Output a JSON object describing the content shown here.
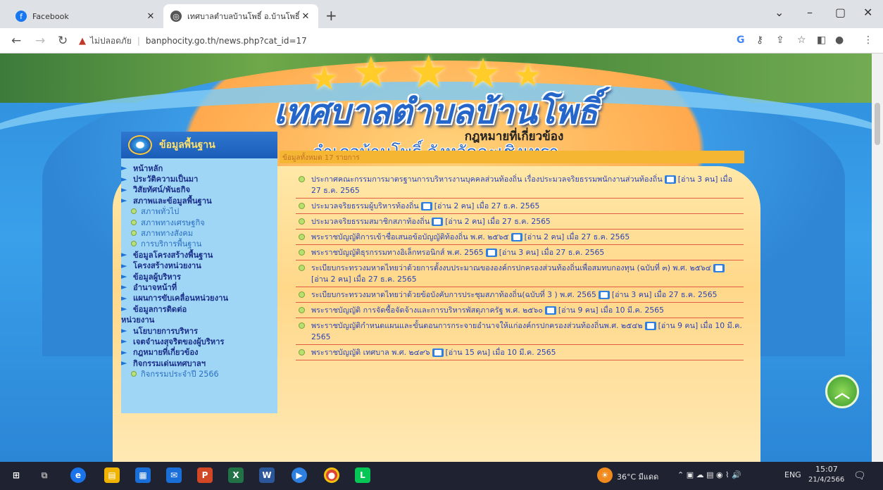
{
  "browser": {
    "tabs": [
      {
        "title": "Facebook",
        "icon": "facebook-icon"
      },
      {
        "title": "เทศบาลตำบลบ้านโพธิ์ อ.บ้านโพธิ์ จ.ฉะ",
        "icon": "globe-icon"
      }
    ],
    "address": {
      "security_label": "ไม่ปลอดภัย",
      "url": "banphocity.go.th/news.php?cat_id=17"
    }
  },
  "site": {
    "title": "เทศบาลตำบลบ้านโพธิ์",
    "subtitle": "อำเภอบ้านโพธิ์ จังหวัดฉะเชิงเทรา"
  },
  "sidebar": {
    "heading": "ข้อมูลพื้นฐาน",
    "items": [
      {
        "label": "หน้าหลัก",
        "type": "main"
      },
      {
        "label": "ประวัติความเป็นมา",
        "type": "main"
      },
      {
        "label": "วิสัยทัศน์/พันธกิจ",
        "type": "main"
      },
      {
        "label": "สภาพและข้อมูลพื้นฐาน",
        "type": "main"
      },
      {
        "label": "สภาพทั่วไป",
        "type": "sub"
      },
      {
        "label": "สภาพทางเศรษฐกิจ",
        "type": "sub"
      },
      {
        "label": "สภาพทางสังคม",
        "type": "sub"
      },
      {
        "label": "การบริการพื้นฐาน",
        "type": "sub"
      },
      {
        "label": "ข้อมูลโครงสร้างพื้นฐาน",
        "type": "main"
      },
      {
        "label": "โครงสร้างหน่วยงาน",
        "type": "main"
      },
      {
        "label": "ข้อมูลผู้บริหาร",
        "type": "main"
      },
      {
        "label": "อำนาจหน้าที่",
        "type": "main"
      },
      {
        "label": "แผนการขับเคลื่อนหน่วยงาน",
        "type": "main"
      },
      {
        "label": "ข้อมูลการติดต่อ",
        "type": "main"
      },
      {
        "label": "หน่วยงาน",
        "type": "cont"
      },
      {
        "label": "นโยบายการบริหาร",
        "type": "main"
      },
      {
        "label": "เจตจำนงสุจริตของผู้บริหาร",
        "type": "main"
      },
      {
        "label": "กฎหมายที่เกี่ยวข้อง",
        "type": "main"
      },
      {
        "label": "กิจกรรมเด่นเทศบาลฯ",
        "type": "main"
      },
      {
        "label": "กิจกรรมประจำปี 2566",
        "type": "sub"
      }
    ]
  },
  "main": {
    "title": "กฎหมายที่เกี่ยวข้อง",
    "count_text": "ข้อมูลทั้งหมด 17 รายการ",
    "items": [
      {
        "text": "ประกาศคณะกรรมการมาตรฐานการบริหารงานบุคคลส่วนท้องถิ่น เรื่องประมวลจริยธรรมพนักงานส่วนท้องถิ่น",
        "meta": "[อ่าน 3 คน] เมื่อ 27 ธ.ค. 2565"
      },
      {
        "text": "ประมวลจริยธรรมผู้บริหารท้องถิ่น",
        "meta": "[อ่าน 2 คน] เมื่อ 27 ธ.ค. 2565"
      },
      {
        "text": "ประมวลจริยธรรมสมาชิกสภาท้องถิ่น",
        "meta": "[อ่าน 2 คน] เมื่อ 27 ธ.ค. 2565"
      },
      {
        "text": "พระราชบัญญัติการเข้าชื่อเสนอข้อบัญญัติท้องถิ่น พ.ศ. ๒๕๖๕",
        "meta": "[อ่าน 2 คน] เมื่อ 27 ธ.ค. 2565"
      },
      {
        "text": "พระราชบัญญัติธุรกรรมทางอิเล็กทรอนิกส์ พ.ศ. 2565",
        "meta": "[อ่าน 3 คน] เมื่อ 27 ธ.ค. 2565"
      },
      {
        "text": "ระเบียบกระทรวงมหาดไทยว่าด้วยการตั้งงบประมาณขององค์กรปกครองส่วนท้องถิ่นเพื่อสมทบกองทุน (ฉบับที่ ๓) พ.ศ. ๒๕๖๔",
        "meta": "[อ่าน 2 คน] เมื่อ 27 ธ.ค. 2565"
      },
      {
        "text": "ระเบียบกระทรวงมหาดไทยว่าด้วยข้อบังคับการประชุมสภาท้องถิ่น(ฉบับที่ 3 ) พ.ศ. 2565",
        "meta": "[อ่าน 3 คน] เมื่อ 27 ธ.ค. 2565"
      },
      {
        "text": "พระราชบัญญัติ การจัดซื้อจัดจ้างและการบริหารพัสดุภาครัฐ พ.ศ. ๒๕๖๐",
        "meta": "[อ่าน 9 คน] เมื่อ 10 มี.ค. 2565"
      },
      {
        "text": "พระราชบัญญัติกำหนดแผนและขั้นตอนการกระจายอำนาจให้แก่องค์กรปกครองส่วนท้องถิ่นพ.ศ. ๒๕๔๒",
        "meta": "[อ่าน 9 คน] เมื่อ 10 มี.ค. 2565"
      },
      {
        "text": "พระราชบัญญัติ เทศบาล พ.ศ. ๒๔๙๖",
        "meta": "[อ่าน 15 คน] เมื่อ 10 มี.ค. 2565"
      }
    ]
  },
  "taskbar": {
    "weather": "36°C มีแดด",
    "lang": "ENG",
    "time": "15:07",
    "date": "21/4/2566"
  },
  "colors": {
    "link": "#2b44b6",
    "divider": "#e25b45",
    "sidebar_bg": "#9fd6f5",
    "count_bar": "#f5b733"
  }
}
